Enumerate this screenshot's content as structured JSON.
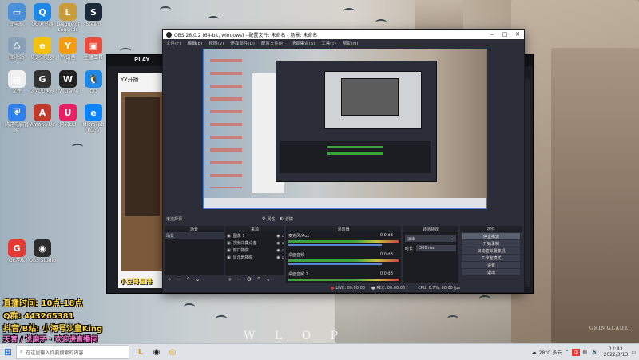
{
  "desktop_icons": [
    {
      "label": "此电脑",
      "color": "#4a90d9",
      "glyph": "▭"
    },
    {
      "label": "QQ浏览器",
      "color": "#1e88e5",
      "glyph": "Q"
    },
    {
      "label": "League of Legends",
      "color": "#c89b3c",
      "glyph": "L"
    },
    {
      "label": "Steam",
      "color": "#1b2838",
      "glyph": "S"
    },
    {
      "label": "回收站",
      "color": "#8aa0b5",
      "glyph": "♺"
    },
    {
      "label": "极速浏览器",
      "color": "#f4c20d",
      "glyph": "e"
    },
    {
      "label": "YY语音",
      "color": "#f39c12",
      "glyph": "Y"
    },
    {
      "label": "主播工具",
      "color": "#e74c3c",
      "glyph": "▣"
    },
    {
      "label": "文件",
      "color": "#f0f0f0",
      "glyph": "▤"
    },
    {
      "label": "游戏加速器",
      "color": "#333333",
      "glyph": "G"
    },
    {
      "label": "WeGame",
      "color": "#222222",
      "glyph": "W"
    },
    {
      "label": "QQ",
      "color": "#1e88e5",
      "glyph": "🐧"
    },
    {
      "label": "腾讯电脑管家",
      "color": "#2f80ed",
      "glyph": "⛨"
    },
    {
      "label": "Among Us",
      "color": "#c0392b",
      "glyph": "A"
    },
    {
      "label": "网易UU",
      "color": "#e91e63",
      "glyph": "U"
    },
    {
      "label": "Microsoft Edge",
      "color": "#0a84ff",
      "glyph": "e"
    },
    {
      "label": "GF游戏",
      "color": "#e53935",
      "glyph": "G"
    },
    {
      "label": "OBS Studio",
      "color": "#2d2d2d",
      "glyph": "◉"
    }
  ],
  "overlay": {
    "live_time": "直播时间: 10点-18点",
    "qq": "Q群: 443265381",
    "douyin": "抖音/B站: 小海号沙皇King",
    "slogan": "天青 / 说磨子 · 欢迎进直播间"
  },
  "wallpaper": {
    "watermark": "W L O P",
    "credit": "GRIMGLADE"
  },
  "yy_window": {
    "tab": "PLAY",
    "title": "YY开播",
    "bottom_text": "小豆哥直播"
  },
  "obs": {
    "title": "OBS 26.0.2 (64-bit, windows) - 配置文件: 未命名 - 场景: 未命名",
    "menu": [
      "文件(F)",
      "编辑(E)",
      "视图(V)",
      "停靠部件(D)",
      "配置文件(P)",
      "场景集合(S)",
      "工具(T)",
      "帮助(H)"
    ],
    "no_source": "未选择源",
    "props_btn": "属性",
    "filters_btn": "滤镜",
    "docks": {
      "scenes": {
        "title": "场景",
        "items": [
          "场景"
        ]
      },
      "sources": {
        "title": "来源",
        "items": [
          "图像 1",
          "视频采集设备",
          "窗口捕获",
          "显示器捕获"
        ]
      },
      "mixer": {
        "title": "混音器",
        "rows": [
          {
            "name": "麦克风/Aux",
            "db": "0.0 dB"
          },
          {
            "name": "桌面音频",
            "db": "0.0 dB"
          },
          {
            "name": "桌面音频 2",
            "db": "0.0 dB"
          }
        ]
      },
      "transitions": {
        "title": "转场特效",
        "type": "淡出",
        "duration_label": "时长",
        "duration": "300 ms"
      },
      "controls": {
        "title": "控件",
        "buttons": [
          "停止推流",
          "开始录制",
          "启动虚拟摄像机",
          "工作室模式",
          "设置",
          "退出"
        ]
      }
    },
    "status": {
      "live": "LIVE: 00:00:00",
      "rec": "REC: 00:00:00",
      "cpu": "CPU: 0.7%, 60.00 fps"
    }
  },
  "taskbar": {
    "search_placeholder": "在这里输入你要搜索的内容",
    "weather": "28°C 多云",
    "ime": "中",
    "time": "12:43",
    "date": "2022/3/13"
  },
  "colors": {
    "obs_bg": "#2b2e38",
    "obs_panel": "#1b1d23",
    "overlay_gold": "#ffd84a",
    "overlay_pink": "#ff7bd5"
  }
}
